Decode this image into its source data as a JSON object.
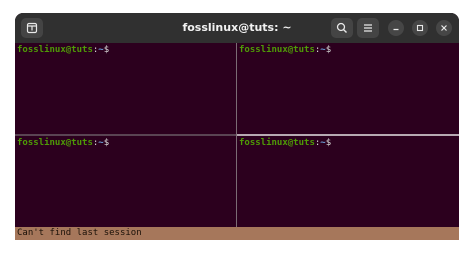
{
  "window": {
    "title": "fosslinux@tuts: ~"
  },
  "icons": {
    "new_tab": "new-tab-icon",
    "search": "search-icon",
    "menu": "hamburger-menu-icon",
    "minimize": "minimize-icon",
    "maximize": "maximize-icon",
    "close": "close-icon"
  },
  "panes": [
    {
      "user_host": "fosslinux@tuts",
      "sep": ":",
      "path": "~",
      "symbol": "$"
    },
    {
      "user_host": "fosslinux@tuts",
      "sep": ":",
      "path": "~",
      "symbol": "$"
    },
    {
      "user_host": "fosslinux@tuts",
      "sep": ":",
      "path": "~",
      "symbol": "$"
    },
    {
      "user_host": "fosslinux@tuts",
      "sep": ":",
      "path": "~",
      "symbol": "$"
    }
  ],
  "status": {
    "message": "Can't find last session"
  },
  "colors": {
    "terminal_bg": "#2c001e",
    "prompt_user": "#4e9a06",
    "prompt_path": "#6d9fd8",
    "status_bg": "#a6775b",
    "titlebar_bg": "#303030"
  }
}
